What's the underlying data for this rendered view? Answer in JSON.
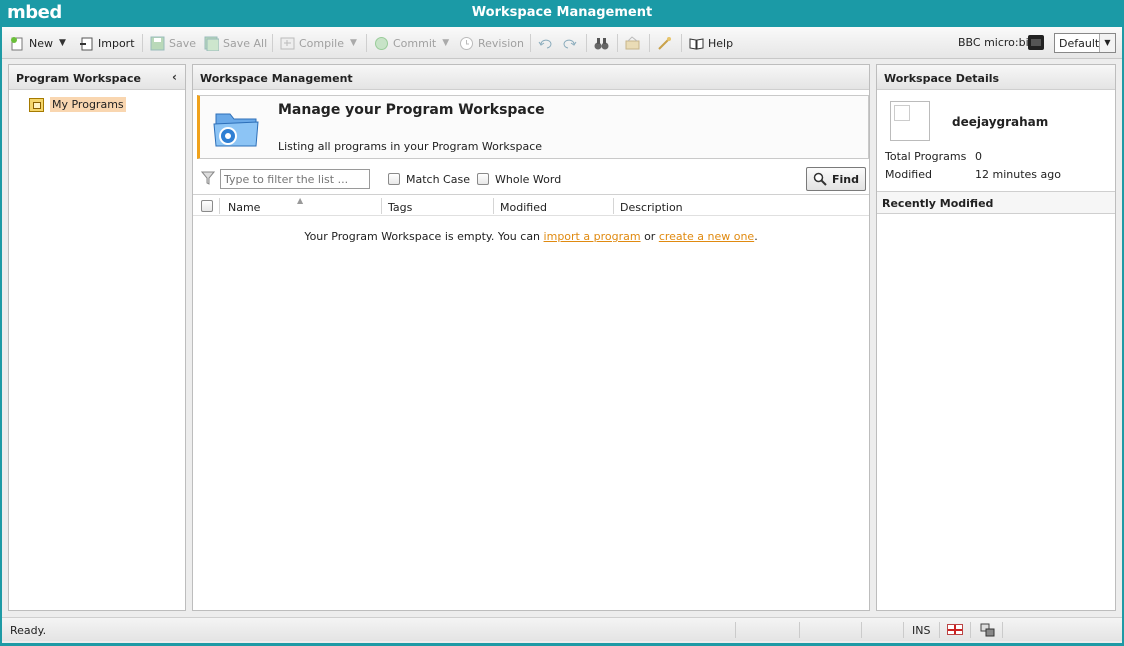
{
  "app": {
    "logo": "mbed",
    "window_title": "Workspace Management"
  },
  "toolbar": {
    "new_label": "New",
    "import_label": "Import",
    "save_label": "Save",
    "save_all_label": "Save All",
    "compile_label": "Compile",
    "commit_label": "Commit",
    "revision_label": "Revision",
    "help_label": "Help",
    "platform_label": "BBC micro:bit",
    "profile_selected": "Default"
  },
  "left_panel": {
    "title": "Program Workspace",
    "tree": [
      {
        "label": "My Programs",
        "icon": "programs-folder-icon"
      }
    ]
  },
  "center_panel": {
    "title": "Workspace Management",
    "banner_title": "Manage your Program Workspace",
    "banner_subtitle": "Listing all programs in your Program Workspace",
    "filter_placeholder": "Type to filter the list ...",
    "match_case_label": "Match Case",
    "whole_word_label": "Whole Word",
    "find_label": "Find",
    "columns": [
      "Name",
      "Tags",
      "Modified",
      "Description"
    ],
    "empty_prefix": "Your Program Workspace is empty. You can",
    "import_link": "import a program",
    "or_text": "or",
    "create_link": "create a new one",
    "period": "."
  },
  "right_panel": {
    "title": "Workspace Details",
    "username": "deejaygraham",
    "total_programs_label": "Total Programs",
    "total_programs_value": "0",
    "modified_label": "Modified",
    "modified_value": "12 minutes ago",
    "recently_modified_title": "Recently Modified"
  },
  "statusbar": {
    "status": "Ready.",
    "ins": "INS"
  },
  "colors": {
    "brand": "#1b9aa6",
    "accent": "#f0a21c",
    "link": "#e08a10"
  }
}
